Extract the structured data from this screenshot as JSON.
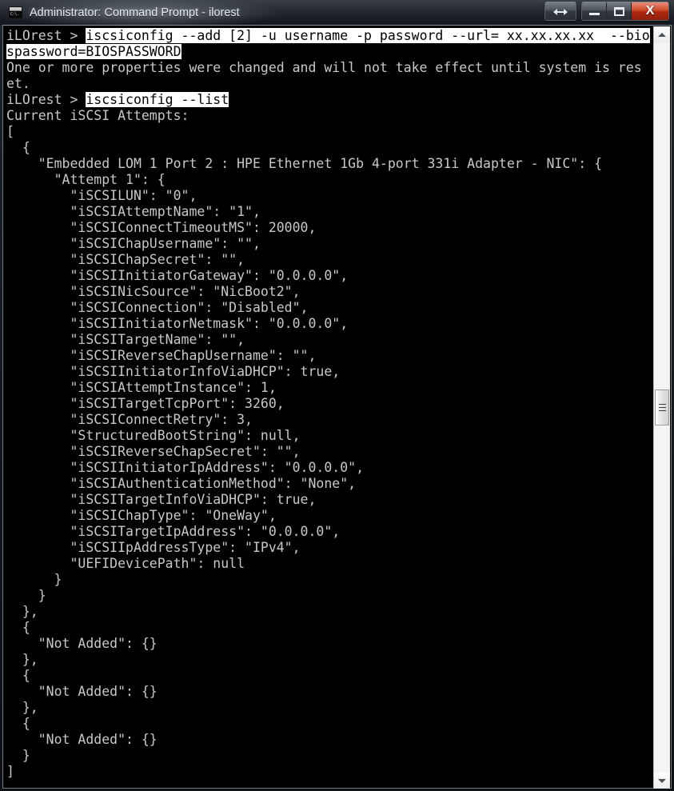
{
  "window": {
    "title": "Administrator: Command Prompt - ilorest",
    "app_icon_text": "C:\\.",
    "buttons": {
      "resize_label": "Resize",
      "minimize_label": "Minimize",
      "maximize_label": "Maximize",
      "close_label": "X"
    }
  },
  "scrollbar": {
    "up_arrow": "▲",
    "down_arrow": "▼"
  },
  "console": {
    "prompt": "iLOrest > ",
    "lines": [
      {
        "id": 1,
        "prefix": "iLOrest > ",
        "selected": "iscsiconfig --add [2] -u username -p password --url= xx.xx.xx.xx  --bio",
        "text": ""
      },
      {
        "id": 2,
        "prefix": "",
        "selected": "spassword=BIOSPASSWORD",
        "text": ""
      },
      {
        "id": 3,
        "prefix": "",
        "selected": "",
        "text": "One or more properties were changed and will not take effect until system is res"
      },
      {
        "id": 4,
        "prefix": "",
        "selected": "",
        "text": "et."
      },
      {
        "id": 5,
        "prefix": "iLOrest > ",
        "selected": "iscsiconfig --list",
        "text": ""
      },
      {
        "id": 6,
        "prefix": "",
        "selected": "",
        "text": "Current iSCSI Attempts:"
      },
      {
        "id": 7,
        "prefix": "",
        "selected": "",
        "text": "["
      },
      {
        "id": 8,
        "prefix": "",
        "selected": "",
        "text": "  {"
      },
      {
        "id": 9,
        "prefix": "",
        "selected": "",
        "text": "    \"Embedded LOM 1 Port 2 : HPE Ethernet 1Gb 4-port 331i Adapter - NIC\": {"
      },
      {
        "id": 10,
        "prefix": "",
        "selected": "",
        "text": "      \"Attempt 1\": {"
      },
      {
        "id": 11,
        "prefix": "",
        "selected": "",
        "text": "        \"iSCSILUN\": \"0\","
      },
      {
        "id": 12,
        "prefix": "",
        "selected": "",
        "text": "        \"iSCSIAttemptName\": \"1\","
      },
      {
        "id": 13,
        "prefix": "",
        "selected": "",
        "text": "        \"iSCSIConnectTimeoutMS\": 20000,"
      },
      {
        "id": 14,
        "prefix": "",
        "selected": "",
        "text": "        \"iSCSIChapUsername\": \"\","
      },
      {
        "id": 15,
        "prefix": "",
        "selected": "",
        "text": "        \"iSCSIChapSecret\": \"\","
      },
      {
        "id": 16,
        "prefix": "",
        "selected": "",
        "text": "        \"iSCSIInitiatorGateway\": \"0.0.0.0\","
      },
      {
        "id": 17,
        "prefix": "",
        "selected": "",
        "text": "        \"iSCSINicSource\": \"NicBoot2\","
      },
      {
        "id": 18,
        "prefix": "",
        "selected": "",
        "text": "        \"iSCSIConnection\": \"Disabled\","
      },
      {
        "id": 19,
        "prefix": "",
        "selected": "",
        "text": "        \"iSCSIInitiatorNetmask\": \"0.0.0.0\","
      },
      {
        "id": 20,
        "prefix": "",
        "selected": "",
        "text": "        \"iSCSITargetName\": \"\","
      },
      {
        "id": 21,
        "prefix": "",
        "selected": "",
        "text": "        \"iSCSIReverseChapUsername\": \"\","
      },
      {
        "id": 22,
        "prefix": "",
        "selected": "",
        "text": "        \"iSCSIInitiatorInfoViaDHCP\": true,"
      },
      {
        "id": 23,
        "prefix": "",
        "selected": "",
        "text": "        \"iSCSIAttemptInstance\": 1,"
      },
      {
        "id": 24,
        "prefix": "",
        "selected": "",
        "text": "        \"iSCSITargetTcpPort\": 3260,"
      },
      {
        "id": 25,
        "prefix": "",
        "selected": "",
        "text": "        \"iSCSIConnectRetry\": 3,"
      },
      {
        "id": 26,
        "prefix": "",
        "selected": "",
        "text": "        \"StructuredBootString\": null,"
      },
      {
        "id": 27,
        "prefix": "",
        "selected": "",
        "text": "        \"iSCSIReverseChapSecret\": \"\","
      },
      {
        "id": 28,
        "prefix": "",
        "selected": "",
        "text": "        \"iSCSIInitiatorIpAddress\": \"0.0.0.0\","
      },
      {
        "id": 29,
        "prefix": "",
        "selected": "",
        "text": "        \"iSCSIAuthenticationMethod\": \"None\","
      },
      {
        "id": 30,
        "prefix": "",
        "selected": "",
        "text": "        \"iSCSITargetInfoViaDHCP\": true,"
      },
      {
        "id": 31,
        "prefix": "",
        "selected": "",
        "text": "        \"iSCSIChapType\": \"OneWay\","
      },
      {
        "id": 32,
        "prefix": "",
        "selected": "",
        "text": "        \"iSCSITargetIpAddress\": \"0.0.0.0\","
      },
      {
        "id": 33,
        "prefix": "",
        "selected": "",
        "text": "        \"iSCSIIpAddressType\": \"IPv4\","
      },
      {
        "id": 34,
        "prefix": "",
        "selected": "",
        "text": "        \"UEFIDevicePath\": null"
      },
      {
        "id": 35,
        "prefix": "",
        "selected": "",
        "text": "      }"
      },
      {
        "id": 36,
        "prefix": "",
        "selected": "",
        "text": "    }"
      },
      {
        "id": 37,
        "prefix": "",
        "selected": "",
        "text": "  },"
      },
      {
        "id": 38,
        "prefix": "",
        "selected": "",
        "text": "  {"
      },
      {
        "id": 39,
        "prefix": "",
        "selected": "",
        "text": "    \"Not Added\": {}"
      },
      {
        "id": 40,
        "prefix": "",
        "selected": "",
        "text": "  },"
      },
      {
        "id": 41,
        "prefix": "",
        "selected": "",
        "text": "  {"
      },
      {
        "id": 42,
        "prefix": "",
        "selected": "",
        "text": "    \"Not Added\": {}"
      },
      {
        "id": 43,
        "prefix": "",
        "selected": "",
        "text": "  },"
      },
      {
        "id": 44,
        "prefix": "",
        "selected": "",
        "text": "  {"
      },
      {
        "id": 45,
        "prefix": "",
        "selected": "",
        "text": "    \"Not Added\": {}"
      },
      {
        "id": 46,
        "prefix": "",
        "selected": "",
        "text": "  }"
      },
      {
        "id": 47,
        "prefix": "",
        "selected": "",
        "text": "]"
      }
    ]
  },
  "colors": {
    "console_bg": "#000000",
    "console_fg": "#c8c8c8",
    "selection_bg": "#ffffff",
    "selection_fg": "#000000",
    "close_button": "#b02a11"
  }
}
